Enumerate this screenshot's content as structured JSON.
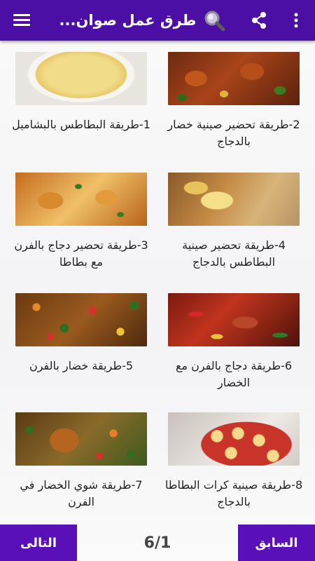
{
  "header": {
    "title": "طرق عمل صوان...",
    "menu_icon": "hamburger-menu-icon",
    "search_icon": "search-icon",
    "share_icon": "share-icon",
    "more_icon": "more-vertical-icon",
    "bg_color": "#4b0fa5"
  },
  "items": [
    {
      "label": "2-طريقة تحضير صينية خضار بالدجاج",
      "image": "roast-chicken-vegetables-photo"
    },
    {
      "label": "1-طريقة البطاطس بالبشاميل",
      "image": "potato-bechamel-gratin-photo"
    },
    {
      "label": "4-طريقة تحضير صينية البطاطس بالدجاج",
      "image": "potato-chicken-tray-photo"
    },
    {
      "label": "3-طريقة تحضير دجاج بالفرن مع بطاطا",
      "image": "oven-chicken-potatoes-photo"
    },
    {
      "label": "6-طريقة دجاج بالفرن مع الخضار",
      "image": "oven-chicken-peppers-photo"
    },
    {
      "label": "5-طريقة خضار بالفرن",
      "image": "roasted-vegetables-photo"
    },
    {
      "label": "8-طريقة صينية كرات البطاطا بالدجاج",
      "image": "potato-balls-tray-photo"
    },
    {
      "label": "7-طريقة شوي الخضار في الفرن",
      "image": "grilled-vegetables-chicken-photo"
    }
  ],
  "footer": {
    "next_label": "التالى",
    "prev_label": "السابق",
    "page_indicator": "6/1",
    "button_color": "#5a10b8"
  }
}
